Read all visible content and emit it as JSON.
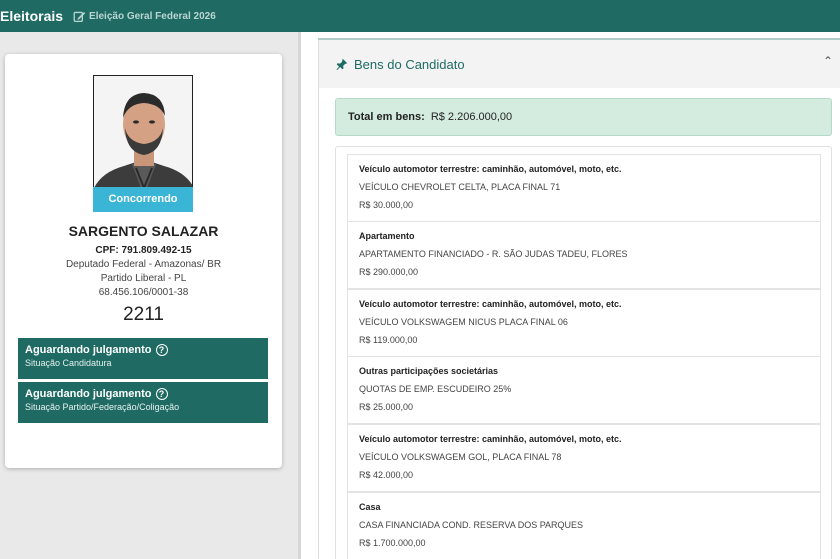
{
  "header": {
    "brand": "Eleitorais",
    "election": "Eleição Geral Federal 2026"
  },
  "candidate": {
    "status": "Concorrendo",
    "name": "SARGENTO SALAZAR",
    "cpf": "CPF: 791.809.492-15",
    "office": "Deputado Federal - Amazonas/ BR",
    "party": "Partido Liberal - PL",
    "cnpj": "68.456.106/0001-38",
    "number": "2211",
    "situations": [
      {
        "title": "Aguardando julgamento",
        "subtitle": "Situação Candidatura"
      },
      {
        "title": "Aguardando julgamento",
        "subtitle": "Situação Partido/Federação/Coligação"
      }
    ]
  },
  "assets": {
    "section_title": "Bens do Candidato",
    "total_label": "Total em bens:",
    "total_value": "R$ 2.206.000,00",
    "items": [
      {
        "kind": "Veículo automotor terrestre: caminhão, automóvel, moto, etc.",
        "desc": "VEÍCULO CHEVROLET CELTA, PLACA FINAL 71",
        "value": "R$ 30.000,00"
      },
      {
        "kind": "Apartamento",
        "desc": "APARTAMENTO FINANCIADO - R. SÃO JUDAS TADEU, FLORES",
        "value": "R$ 290.000,00"
      },
      {
        "kind": "Veículo automotor terrestre: caminhão, automóvel, moto, etc.",
        "desc": "VEÍCULO VOLKSWAGEM NICUS PLACA FINAL 06",
        "value": "R$ 119.000,00"
      },
      {
        "kind": "Outras participações societárias",
        "desc": "QUOTAS DE EMP. ESCUDEIRO 25%",
        "value": "R$ 25.000,00"
      },
      {
        "kind": "Veículo automotor terrestre: caminhão, automóvel, moto, etc.",
        "desc": "VEÍCULO VOLKSWAGEM GOL, PLACA FINAL 78",
        "value": "R$ 42.000,00"
      },
      {
        "kind": "Casa",
        "desc": "CASA FINANCIADA COND. RESERVA DOS PARQUES",
        "value": "R$ 1.700.000,00"
      }
    ]
  },
  "icons": {
    "edit": "edit-icon",
    "pin": "pushpin-icon",
    "collapse": "chevron-up-icon",
    "help": "question-circle-icon"
  },
  "colors": {
    "primary": "#1f6b64",
    "status_chip": "#3ab5d6",
    "total_bg": "#d4ecdf"
  }
}
